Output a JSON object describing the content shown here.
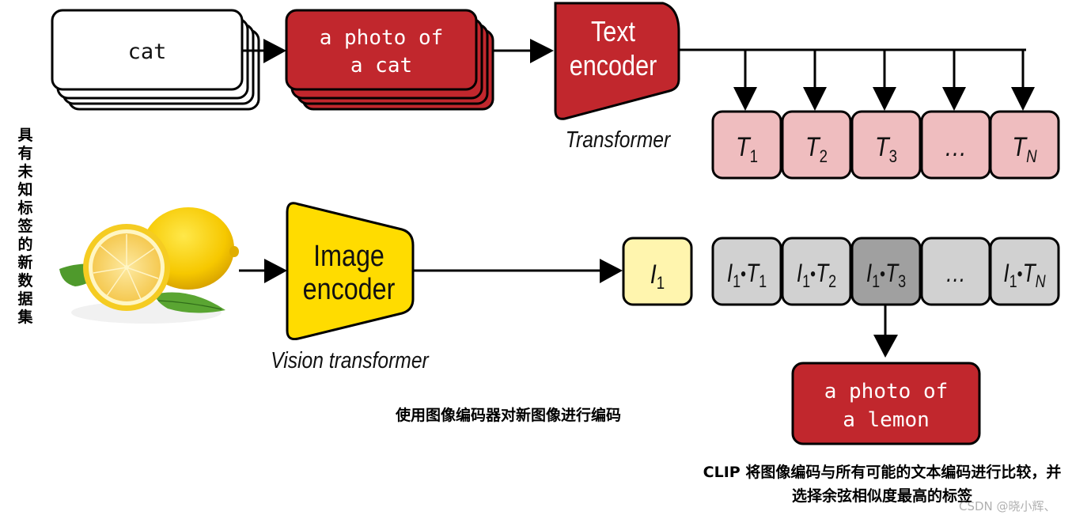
{
  "left_label": "具有未知标签的新数据集",
  "text_branch": {
    "input_label": "cat",
    "prompt_line1": "a photo of",
    "prompt_line2": "a cat",
    "encoder_line1": "Text",
    "encoder_line2": "encoder",
    "encoder_caption": "Transformer",
    "embeddings": [
      {
        "base": "T",
        "sub": "1"
      },
      {
        "base": "T",
        "sub": "2"
      },
      {
        "base": "T",
        "sub": "3"
      },
      {
        "base": "…",
        "sub": ""
      },
      {
        "base": "T",
        "sub": "N"
      }
    ]
  },
  "image_branch": {
    "image_semantic": "lemon-photo",
    "encoder_line1": "Image",
    "encoder_line2": "encoder",
    "encoder_caption": "Vision transformer",
    "embedding": {
      "base": "I",
      "sub": "1"
    },
    "similarities": [
      {
        "a": "I",
        "asub": "1",
        "b": "T",
        "bsub": "1",
        "highlighted": false
      },
      {
        "a": "I",
        "asub": "1",
        "b": "T",
        "bsub": "2",
        "highlighted": false
      },
      {
        "a": "I",
        "asub": "1",
        "b": "T",
        "bsub": "3",
        "highlighted": true
      },
      {
        "a": "…",
        "asub": "",
        "b": "",
        "bsub": "",
        "highlighted": false
      },
      {
        "a": "I",
        "asub": "1",
        "b": "T",
        "bsub": "N",
        "highlighted": false
      }
    ],
    "dot_symbol": "•"
  },
  "result": {
    "line1": "a photo of",
    "line2": "a lemon"
  },
  "captions": {
    "image_encode": "使用图像编码器对新图像进行编码",
    "compare": "CLIP 将图像编码与所有可能的文本编码进行比较，并选择余弦相似度最高的标签"
  },
  "watermark": "CSDN @晓小辉、",
  "colors": {
    "red": "#c1272d",
    "pink": "#efbdbf",
    "yellow": "#ffdc00",
    "pale_yellow": "#fff5ae",
    "gray": "#d1d1d1",
    "dark_gray": "#a0a0a0"
  }
}
